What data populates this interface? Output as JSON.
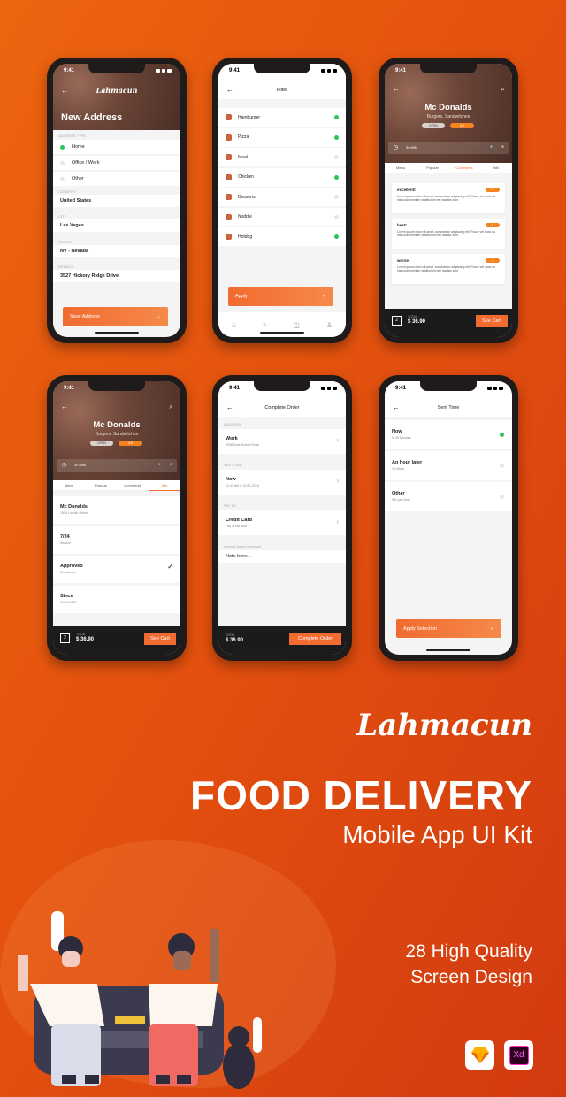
{
  "status_time": "9:41",
  "colors": {
    "accent": "#f26b30",
    "green": "#2ec45a",
    "dark": "#1c1b1b",
    "bg": "#e4520e"
  },
  "new_address": {
    "logo": "Lahmacun",
    "title": "New Address",
    "address_type_label": "ADDRESS TYPE",
    "types": [
      {
        "label": "Home",
        "selected": true
      },
      {
        "label": "Office / Work",
        "selected": false
      },
      {
        "label": "Other",
        "selected": false
      }
    ],
    "country_label": "COUNTRY",
    "country": "United States",
    "city_label": "CITY",
    "city": "Las Vegas",
    "street_label": "STREET",
    "street": "NV - Nevada",
    "details_label": "DETAILS",
    "details": "3527  Hickory Ridge Drive",
    "save_button": "Save Address"
  },
  "filter": {
    "title": "Filter",
    "items": [
      {
        "label": "Hamburger",
        "icon": "hamburger-icon",
        "on": true
      },
      {
        "label": "Pizza",
        "icon": "pizza-icon",
        "on": true
      },
      {
        "label": "Meal",
        "icon": "meal-icon",
        "on": false
      },
      {
        "label": "Chicken",
        "icon": "chicken-icon",
        "on": true
      },
      {
        "label": "Desserts",
        "icon": "dessert-icon",
        "on": false
      },
      {
        "label": "Noddle",
        "icon": "noodle-icon",
        "on": false
      },
      {
        "label": "Hotdog",
        "icon": "hotdog-icon",
        "on": true
      }
    ],
    "apply_button": "Apply"
  },
  "restaurant": {
    "name": "Mc Donalds",
    "cuisine": "Burgers, Sandwitches",
    "open_tag": "OPEN",
    "rating_tag": "4.5",
    "time": "30 MIN",
    "tabs": [
      "Menu",
      "Popular",
      "Comments",
      "Info"
    ],
    "comments": [
      {
        "title": "excellent!",
        "rating": "5",
        "text": "Lorem ipsum dolor sit amet, consectetur adipiscing elit. Fusce vel nunc eu nisi condimentum vestibulum nec facilisis sem."
      },
      {
        "title": "best!",
        "rating": "4",
        "text": "Lorem ipsum dolor sit amet, consectetur adipiscing elit. Fusce vel nunc eu nisi condimentum vestibulum nec facilisis sem."
      },
      {
        "title": "worse!",
        "rating": "2",
        "text": "Lorem ipsum dolor sit amet, consectetur adipiscing elit. Fusce vel nunc eu nisi condimentum vestibulum nec facilisis sem."
      }
    ],
    "info": [
      {
        "title": "Mc Donalds",
        "sub": "1936 Lincoln Street",
        "check": false
      },
      {
        "title": "7/24",
        "sub": "Service",
        "check": false
      },
      {
        "title": "Approved",
        "sub": "Restaurant",
        "check": true
      },
      {
        "title": "Since",
        "sub": "01-01-2018",
        "check": false
      }
    ]
  },
  "cart": {
    "quantity": "2",
    "total_label": "TOTAL",
    "total": "$ 36.90",
    "see_cart": "See Cart"
  },
  "complete_order": {
    "title": "Complete Order",
    "sections": [
      {
        "label": "ADDRESS",
        "title": "Work",
        "sub": "4336 Dark Hollow Road"
      },
      {
        "label": "SENT TIME",
        "title": "Now",
        "sub": "12:41 AM # 13-03-2018"
      },
      {
        "label": "PAY TO",
        "title": "Credit Card",
        "sub": "Pay at the door"
      }
    ],
    "notes_label": "Special Notes (optional)",
    "notes_placeholder": "Note here...",
    "button": "Complete Order"
  },
  "sent_time": {
    "title": "Sent Time",
    "options": [
      {
        "title": "Now",
        "sub": "In 45 Minutes",
        "selected": true
      },
      {
        "title": "An hour later",
        "sub": "12:45am",
        "selected": false
      },
      {
        "title": "Other",
        "sub": "Set your time",
        "selected": false
      }
    ],
    "button": "Apply Selection"
  },
  "promo": {
    "logo": "Lahmacun",
    "headline": "FOOD DELIVERY",
    "subheadline": "Mobile App UI Kit",
    "feature_line1": "28 High Quality",
    "feature_line2": "Screen Design",
    "tools": [
      "Sketch",
      "Xd"
    ]
  }
}
